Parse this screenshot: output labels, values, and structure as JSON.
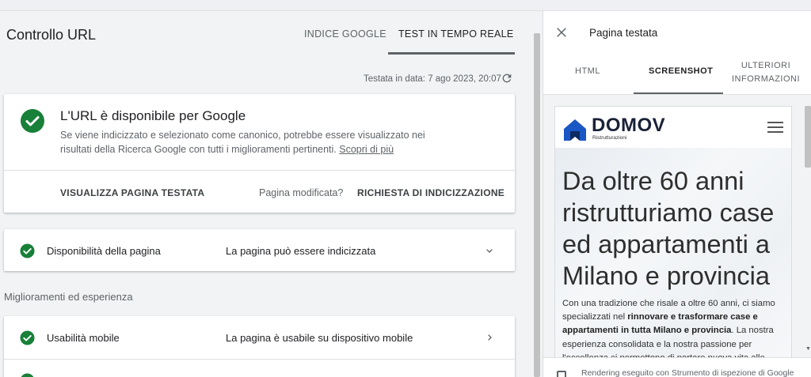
{
  "header": {
    "title": "Controllo URL",
    "tabs": [
      {
        "label": "INDICE GOOGLE",
        "active": false
      },
      {
        "label": "TEST IN TEMPO REALE",
        "active": true
      }
    ],
    "tested_date": "Testata in data: 7 ago 2023, 20:07"
  },
  "main_card": {
    "heading": "L'URL è disponibile per Google",
    "description": "Se viene indicizzato e selezionato come canonico, potrebbe essere visualizzato nei risultati della Ricerca Google con tutti i miglioramenti pertinenti.",
    "learn_more": "Scopri di più",
    "view_button": "VISUALIZZA PAGINA TESTATA",
    "modified_label": "Pagina modificata?",
    "request_button": "RICHIESTA DI INDICIZZAZIONE"
  },
  "availability": {
    "label": "Disponibilità della pagina",
    "value": "La pagina può essere indicizzata"
  },
  "enhancements": {
    "section_label": "Miglioramenti ed esperienza",
    "items": [
      {
        "label": "Usabilità mobile",
        "value": "La pagina è usabile su dispositivo mobile"
      }
    ]
  },
  "panel": {
    "title": "Pagina testata",
    "tabs": [
      {
        "label": "HTML",
        "active": false
      },
      {
        "label": "SCREENSHOT",
        "active": true
      },
      {
        "label": "ULTERIORI INFORMAZIONI",
        "active": false
      }
    ],
    "footer_text": "Rendering eseguito con Strumento di ispezione di Google"
  },
  "screenshot": {
    "logo_text": "DOMOV",
    "logo_subtitle": "Ristrutturazioni",
    "hero_title": "Da oltre 60 anni ristrutturiamo case ed appartamenti a Milano e provincia",
    "hero_text_1": "Con una tradizione che risale a oltre 60 anni, ci siamo specializzati nel ",
    "hero_text_bold": "rinnovare e trasformare case e appartamenti in tutta Milano e provincia",
    "hero_text_2": ". La nostra esperienza consolidata e la nostra passione per l'eccellenza ci permettono di portare nuova vita alle"
  },
  "colors": {
    "success_green": "#188038",
    "brand_blue": "#1a56c4"
  },
  "icons": [
    "check-circle-icon",
    "refresh-icon",
    "chevron-down-icon",
    "chevron-right-icon",
    "close-icon",
    "menu-icon",
    "device-icon"
  ]
}
